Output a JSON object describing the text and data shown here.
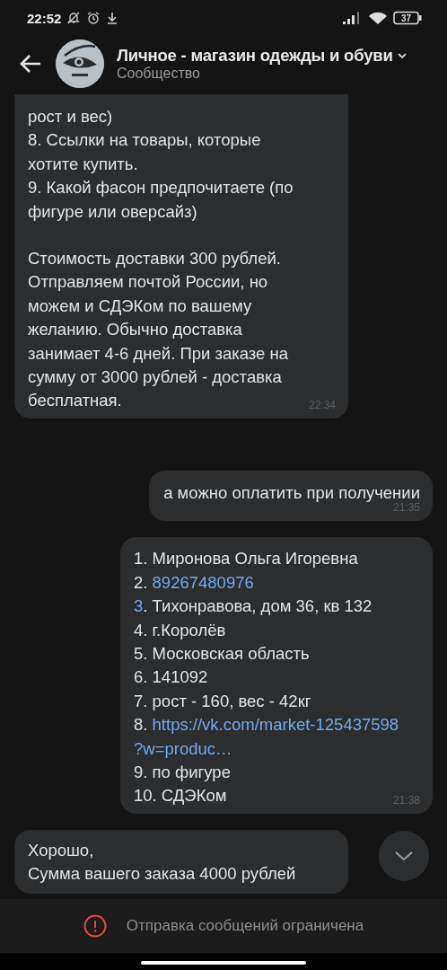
{
  "status_bar": {
    "time": "22:52",
    "battery": "37"
  },
  "header": {
    "title": "Личное - магазин одежды и обуви",
    "subtitle": "Сообщество"
  },
  "messages": [
    {
      "kind": "incoming",
      "cut_top": true,
      "paragraphs": [
        [
          "рост и вес)",
          "8. Ссылки на товары, которые",
          "хотите купить.",
          "9. Какой фасон предпочитаете (по",
          "фигуре или оверсайз)"
        ],
        [
          "Стоимость доставки 300 рублей.",
          "Отправляем почтой России, но",
          "можем и СДЭКом по вашему",
          "желанию. Обычно доставка",
          "занимает 4-6 дней. При заказе на",
          "сумму от 3000 рублей - доставка",
          "бесплатная."
        ]
      ],
      "time": "22:34"
    },
    {
      "kind": "outgoing",
      "paragraphs": [
        [
          "а можно оплатить при получении"
        ]
      ],
      "time": "21:35"
    },
    {
      "kind": "list",
      "lines": [
        [
          {
            "text": "1. Миронова Ольга Игоревна",
            "link": false
          }
        ],
        [
          {
            "text": "2. ",
            "link": false
          },
          {
            "text": "89267480976",
            "link": true
          }
        ],
        [
          {
            "text": "3",
            "link": true
          },
          {
            "text": ". Тихонравова, дом 36, кв 132",
            "link": false
          }
        ],
        [
          {
            "text": "4. г.Королёв",
            "link": false
          }
        ],
        [
          {
            "text": "5. Московская область",
            "link": false
          }
        ],
        [
          {
            "text": "6. 141092",
            "link": false
          }
        ],
        [
          {
            "text": "7. рост - 160, вес - 42кг",
            "link": false
          }
        ],
        [
          {
            "text": "8. ",
            "link": false
          },
          {
            "text": "https://vk.com/market-125437598",
            "link": true
          }
        ],
        [
          {
            "text": "?w=produc…",
            "link": true
          }
        ],
        [
          {
            "text": "9. по фигуре",
            "link": false
          }
        ],
        [
          {
            "text": "10. СДЭКом",
            "link": false
          }
        ]
      ],
      "time": "21:38"
    },
    {
      "kind": "incoming",
      "cut_top": false,
      "paragraphs": [
        [
          "Хорошо,",
          "Сумма вашего заказа 4000 рублей"
        ]
      ]
    }
  ],
  "notice": {
    "text": "Отправка сообщений ограничена"
  }
}
